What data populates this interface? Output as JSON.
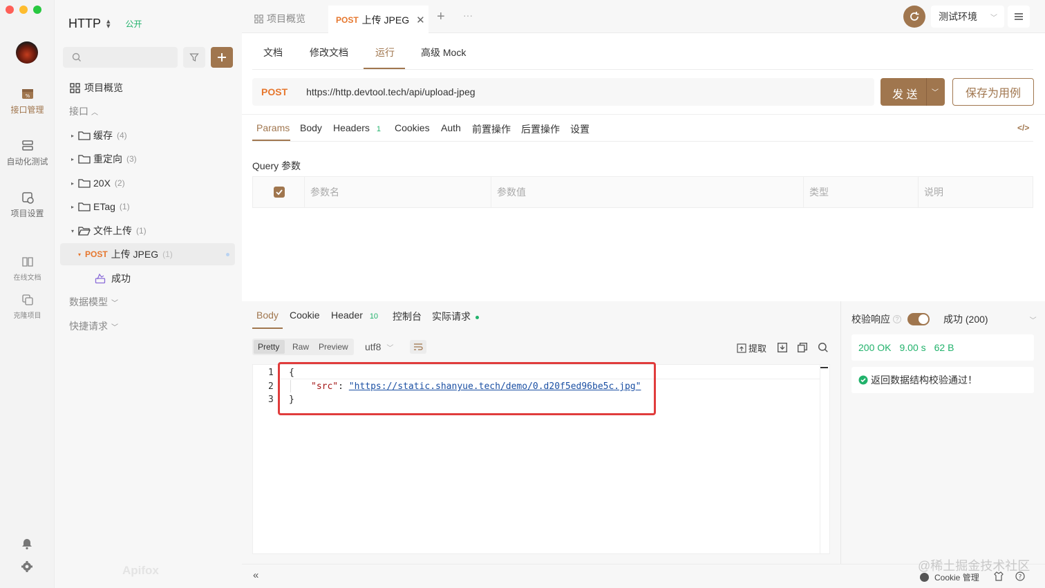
{
  "app": {
    "project_name": "HTTP",
    "public_badge": "公开",
    "brand": "Apifox"
  },
  "rail": {
    "items": [
      {
        "label": "接口管理",
        "icon": "api-icon"
      },
      {
        "label": "自动化测试",
        "icon": "automation-icon"
      },
      {
        "label": "项目设置",
        "icon": "settings-icon"
      },
      {
        "label": "在线文档",
        "icon": "book-icon"
      },
      {
        "label": "克隆项目",
        "icon": "clone-icon"
      }
    ]
  },
  "sidebar": {
    "overview": "项目概览",
    "section_api": "接口",
    "folders": [
      {
        "name": "缓存",
        "count": "(4)"
      },
      {
        "name": "重定向",
        "count": "(3)"
      },
      {
        "name": "20X",
        "count": "(2)"
      },
      {
        "name": "ETag",
        "count": "(1)"
      },
      {
        "name": "文件上传",
        "count": "(1)"
      }
    ],
    "selected_endpoint": {
      "method": "POST",
      "name": "上传 JPEG",
      "count": "(1)"
    },
    "case": "成功",
    "section_models": "数据模型",
    "section_quick": "快捷请求"
  },
  "tabs": {
    "overview": "项目概览",
    "active_method": "POST",
    "active_name": "上传 JPEG",
    "env": "测试环境"
  },
  "subtabs": [
    "文档",
    "修改文档",
    "运行",
    "高级 Mock"
  ],
  "request": {
    "method": "POST",
    "url": "https://http.devtool.tech/api/upload-jpeg",
    "send": "发 送",
    "save_case": "保存为用例"
  },
  "param_tabs": [
    "Params",
    "Body",
    "Headers",
    "Cookies",
    "Auth",
    "前置操作",
    "后置操作",
    "设置"
  ],
  "headers_count": "1",
  "query": {
    "title": "Query 参数",
    "columns": [
      "参数名",
      "参数值",
      "类型",
      "说明"
    ]
  },
  "response": {
    "tabs": [
      "Body",
      "Cookie",
      "Header",
      "控制台",
      "实际请求"
    ],
    "header_count": "10",
    "formats": [
      "Pretty",
      "Raw",
      "Preview"
    ],
    "encoding": "utf8",
    "extract": "提取",
    "code_lines": [
      "1",
      "2",
      "3"
    ],
    "code": {
      "open": "{",
      "key": "\"src\"",
      "colon": ": ",
      "value": "\"https://static.shanyue.tech/demo/0.d20f5ed96be5c.jpg\"",
      "close": "}"
    }
  },
  "validation": {
    "label": "校验响应",
    "result": "成功 (200)",
    "status": "200 OK",
    "time": "9.00 s",
    "size": "62 B",
    "message": "返回数据结构校验通过！"
  },
  "footer": {
    "cookie": "Cookie 管理",
    "watermark": "@稀土掘金技术社区"
  },
  "colors": {
    "accent": "#a0764e",
    "post": "#e6772e",
    "success": "#21b26b",
    "highlight_box": "#e03c3c"
  }
}
